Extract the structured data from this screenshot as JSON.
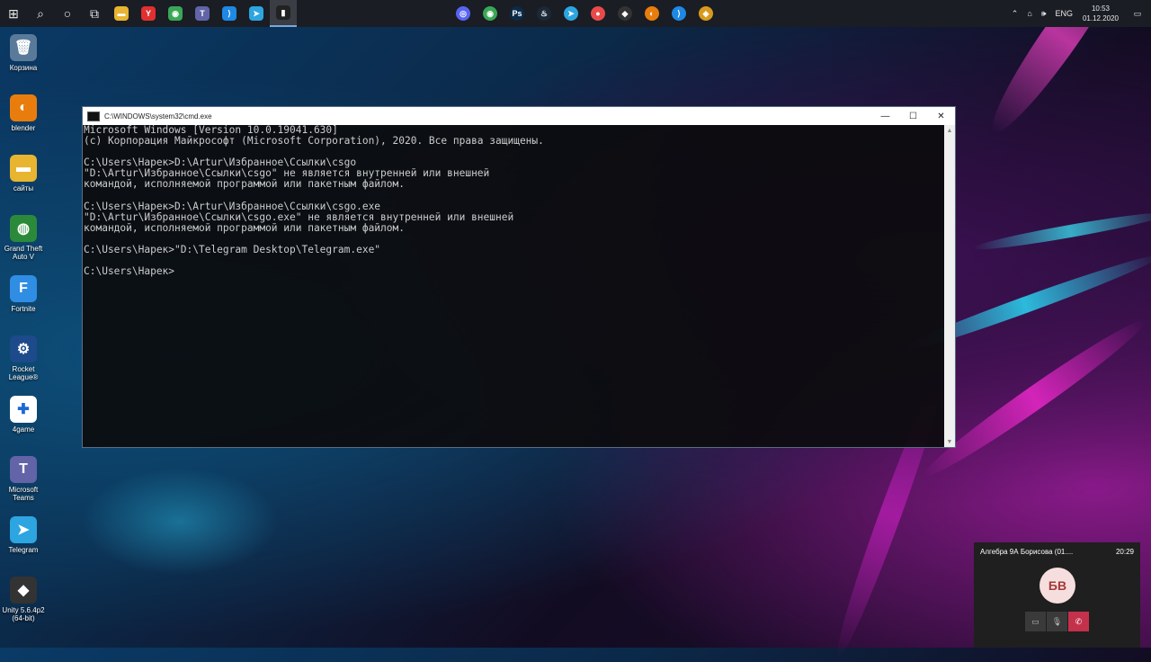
{
  "taskbar": {
    "left_items": [
      {
        "name": "start-button",
        "glyph": "⊞"
      },
      {
        "name": "search-button",
        "glyph": "⌕"
      },
      {
        "name": "cortana-button",
        "glyph": "○"
      },
      {
        "name": "task-view-button",
        "glyph": "⧉"
      },
      {
        "name": "file-explorer-app",
        "glyph": "▬",
        "color": "#e8b530"
      },
      {
        "name": "yandex-browser-app",
        "glyph": "Y",
        "color": "#e03030"
      },
      {
        "name": "chrome-app",
        "glyph": "◉",
        "color": "#3aa757"
      },
      {
        "name": "teams-app",
        "glyph": "T",
        "color": "#6264a7"
      },
      {
        "name": "vscode-app",
        "glyph": "⟩",
        "color": "#1e88e5"
      },
      {
        "name": "telegram-app",
        "glyph": "➤",
        "color": "#2ca5e0"
      },
      {
        "name": "cmd-app",
        "glyph": "▮",
        "color": "#222222"
      }
    ],
    "center_items": [
      {
        "name": "discord-app",
        "glyph": "◎",
        "color": "#5865f2"
      },
      {
        "name": "chrome-app",
        "glyph": "◉",
        "color": "#3aa757"
      },
      {
        "name": "photoshop-app",
        "glyph": "Ps",
        "color": "#0b2b4a"
      },
      {
        "name": "steam-app",
        "glyph": "♨",
        "color": "#1b2838"
      },
      {
        "name": "telegram-app",
        "glyph": "➤",
        "color": "#2ca5e0"
      },
      {
        "name": "lgbt-app",
        "glyph": "●",
        "color": "#e84a4a"
      },
      {
        "name": "unity-app",
        "glyph": "◆",
        "color": "#333333"
      },
      {
        "name": "blender-app",
        "glyph": "◐",
        "color": "#e87d0d"
      },
      {
        "name": "vscode-app",
        "glyph": "⟩",
        "color": "#1e88e5"
      },
      {
        "name": "csgo-app",
        "glyph": "◈",
        "color": "#d89a1e"
      }
    ],
    "tray": {
      "chevron": "⌃",
      "network": "⌂",
      "volume": "🕪",
      "language": "ENG",
      "time": "10:53",
      "date": "01.12.2020",
      "notification": "▭"
    }
  },
  "desktop_icons": [
    {
      "label": "Корзина",
      "glyph": "🗑",
      "color": "#5a7a99"
    },
    {
      "label": "blender",
      "glyph": "◐",
      "color": "#e87d0d"
    },
    {
      "label": "сайты",
      "glyph": "▬",
      "color": "#e8b530"
    },
    {
      "label": "Grand Theft Auto V",
      "glyph": "◍",
      "color": "#2a8a3a"
    },
    {
      "label": "Fortnite",
      "glyph": "F",
      "color": "#2f8de4"
    },
    {
      "label": "Rocket League®",
      "glyph": "⚙",
      "color": "#1d4a8a"
    },
    {
      "label": "4game",
      "glyph": "✚",
      "color": "#ffffff"
    },
    {
      "label": "Microsoft Teams",
      "glyph": "T",
      "color": "#6264a7"
    },
    {
      "label": "Telegram",
      "glyph": "➤",
      "color": "#2ca5e0"
    },
    {
      "label": "Unity 5.6.4p2 (64-bit)",
      "glyph": "◆",
      "color": "#333333"
    }
  ],
  "cmd_window": {
    "title": "C:\\WINDOWS\\system32\\cmd.exe",
    "controls": {
      "minimize": "—",
      "maximize": "☐",
      "close": "✕"
    },
    "lines": [
      "Microsoft Windows [Version 10.0.19041.630]",
      "(c) Корпорация Майкрософт (Microsoft Corporation), 2020. Все права защищены.",
      "",
      "C:\\Users\\Нарек>D:\\Artur\\Избранное\\Ссылки\\csgo",
      "\"D:\\Artur\\Избранное\\Ссылки\\csgo\" не является внутренней или внешней",
      "командой, исполняемой программой или пакетным файлом.",
      "",
      "C:\\Users\\Нарек>D:\\Artur\\Избранное\\Ссылки\\csgo.exe",
      "\"D:\\Artur\\Избранное\\Ссылки\\csgo.exe\" не является внутренней или внешней",
      "командой, исполняемой программой или пакетным файлом.",
      "",
      "C:\\Users\\Нарек>\"D:\\Telegram Desktop\\Telegram.exe\"",
      "",
      "C:\\Users\\Нарек>"
    ],
    "scroll": {
      "up": "▲",
      "down": "▼"
    }
  },
  "call_window": {
    "title": "Алгебра 9А Борисова (01....",
    "duration": "20:29",
    "avatar_initials": "БВ",
    "buttons": {
      "camera": "▭",
      "mic": "🎙",
      "hangup": "✆"
    }
  }
}
